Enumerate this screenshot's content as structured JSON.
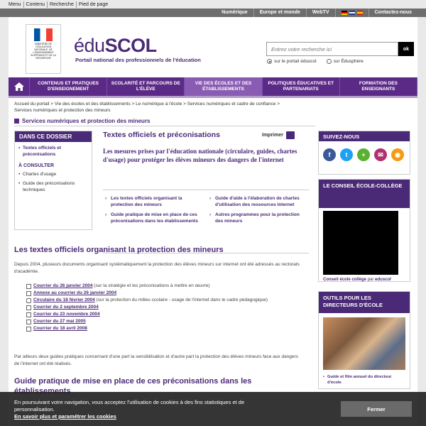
{
  "skip_links": [
    "Menu",
    "Contenu",
    "Recherche",
    "Pied de page"
  ],
  "topbar": {
    "links": [
      "Numérique",
      "Europe et monde",
      "WebTV"
    ],
    "contact": "Contactez-nous"
  },
  "header": {
    "ministry_text": "Ministère de l'Éducation nationale, de l'Enseignement supérieur et de la Recherche",
    "brand_plain": "édu",
    "brand_bold": "SCOL",
    "tagline": "Portail national des professionnels de l'éducation",
    "search_placeholder": "Entrez votre recherche ici",
    "search_button": "ok",
    "radio_1": "sur le portail éduscol",
    "radio_2": "sur Édusphère"
  },
  "nav": [
    "Contenus et pratiques d'enseignement",
    "Scolarité et parcours de l'élève",
    "Vie des écoles et des établissements",
    "Politiques éducatives et partenariats",
    "Formation des enseignants"
  ],
  "breadcrumb": "Accueil du portail > Vie des écoles et des établissements > Le numérique à l'école > Services numériques et cadre de confiance > Services numériques et protection des mineurs",
  "section_title": "Services numériques et protection des mineurs",
  "dossier": {
    "title": "Dans ce dossier",
    "current": "Textes officiels et préconisations",
    "sub_title": "À consulter",
    "links": [
      "Chartes d'usage",
      "Guide des préconisations techniques"
    ]
  },
  "main": {
    "title": "Textes officiels et préconisations",
    "print_label": "Imprimer",
    "lead": "Les mesures prises par l'éducation nationale (circulaire, guides, chartes d'usage) pour protéger les élèves mineurs des dangers de l'internet",
    "toc_left": [
      "Les textes officiels organisant la protection des mineurs",
      "Guide pratique de mise en place de ces préconisations dans les établissements"
    ],
    "toc_right": [
      "Guide d'aide à l'élaboration de chartes d'utilisation des ressources Internet",
      "Autres programmes pour la protection des mineurs"
    ],
    "h2_1": "Les textes officiels organisant la protection des mineurs",
    "intro": "Depuis 2004, plusieurs documents organisant systématiquement la protection des élèves mineurs sur internet ont été adressés au rectorats d'académie.",
    "documents": [
      {
        "link": "Courrier du 26 janvier 2004",
        "note": " (sur la stratégie et les préconisations à mettre en œuvre)"
      },
      {
        "link": "Annexe au courrier du 26 janvier 2004",
        "note": ""
      },
      {
        "link": "Circulaire du 18 février 2004",
        "note": " (sur la protection du milieu scolaire - usage de l'internet dans le cadre pédagogique)"
      },
      {
        "link": "Courrier du 2 septembre 2004",
        "note": ""
      },
      {
        "link": "Courrier du 23 novembre 2004",
        "note": ""
      },
      {
        "link": "Courrier du 27 mai 2005",
        "note": ""
      },
      {
        "link": "Courrier du 18 avril 2008",
        "note": ""
      }
    ],
    "outro": "Par ailleurs deux guides pratiques concernant d'une part la sensibilisation et d'autre part la protection des élèves mineurs face aux dangers de l'internet ont été réalisés.",
    "h2_2": "Guide pratique de mise en place de ces préconisations dans les établissements"
  },
  "sidebar": {
    "suivez": "Suivez-nous",
    "socials": [
      {
        "name": "facebook-icon",
        "glyph": "f",
        "color": "#3b5998"
      },
      {
        "name": "twitter-icon",
        "glyph": "t",
        "color": "#1da1f2"
      },
      {
        "name": "plus-icon",
        "glyph": "+",
        "color": "#5ab030"
      },
      {
        "name": "share-icon",
        "glyph": "✉",
        "color": "#b03070"
      },
      {
        "name": "rss-icon",
        "glyph": "◉",
        "color": "#f39c12"
      }
    ],
    "conseil_title": "Le conseil école-collège",
    "conseil_caption_1": "Conseil école collège",
    "conseil_caption_2": " par ",
    "conseil_caption_3": "eduscol",
    "outils_title": "Outils pour les directeurs d'école",
    "outils_caption": "Guide et film annuel du directeur d'école"
  },
  "cookie": {
    "text": "En poursuivant votre navigation, vous acceptez l'utilisation de cookies à des fins statistiques et de personnalisation.",
    "link": "En savoir plus et paramétrer les cookies",
    "button": "Fermer"
  }
}
